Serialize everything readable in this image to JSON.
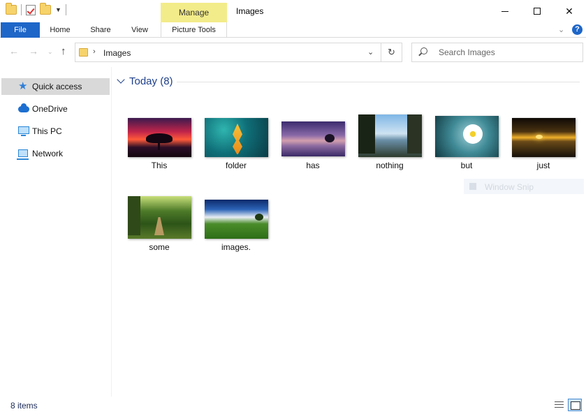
{
  "window": {
    "title": "Images",
    "context_tab": "Manage",
    "accent": "#1e66c8",
    "context_color": "#f3ec8a"
  },
  "ribbon": {
    "tabs": [
      "File",
      "Home",
      "Share",
      "View",
      "Picture Tools"
    ],
    "help_label": "?"
  },
  "address": {
    "path": "Images",
    "search_placeholder": "Search Images"
  },
  "sidebar": {
    "items": [
      {
        "label": "Quick access",
        "icon": "star-icon",
        "selected": true
      },
      {
        "label": "OneDrive",
        "icon": "cloud-icon"
      },
      {
        "label": "This PC",
        "icon": "computer-icon"
      },
      {
        "label": "Network",
        "icon": "network-icon"
      }
    ]
  },
  "content": {
    "group_title": "Today (8)",
    "files": [
      {
        "name": "This"
      },
      {
        "name": "folder"
      },
      {
        "name": "has"
      },
      {
        "name": "nothing"
      },
      {
        "name": "but"
      },
      {
        "name": "just"
      },
      {
        "name": "some"
      },
      {
        "name": "images."
      }
    ],
    "ghost_label": "Window Snip"
  },
  "status": {
    "item_count": "8 items"
  }
}
